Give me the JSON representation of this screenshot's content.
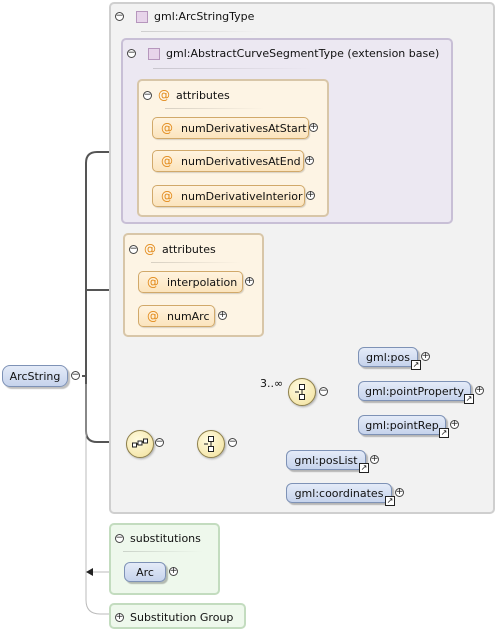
{
  "root": {
    "label": "ArcString"
  },
  "complex_type": {
    "name": "gml:ArcStringType"
  },
  "base_type": {
    "name": "gml:AbstractCurveSegmentType (extension base)"
  },
  "base_attributes": {
    "title": "attributes",
    "items": [
      "numDerivativesAtStart",
      "numDerivativesAtEnd",
      "numDerivativeInterior"
    ]
  },
  "own_attributes": {
    "title": "attributes",
    "items": [
      "interpolation",
      "numArc"
    ]
  },
  "choice": {
    "cardinality": "3..∞",
    "items": [
      "gml:pos",
      "gml:pointProperty",
      "gml:pointRep"
    ]
  },
  "alternatives": [
    "gml:posList",
    "gml:coordinates"
  ],
  "substitutions": {
    "title": "substitutions",
    "items": [
      "Arc"
    ]
  },
  "substitution_group": {
    "label": "Substitution Group"
  },
  "symbols": {
    "collapse": "−",
    "expand": "+",
    "at": "@",
    "link": "↗"
  },
  "colors": {
    "attribute_panel": "#fdf4e4",
    "element_pill": "#c6d3ec",
    "base_panel": "#ece8f2",
    "substitution_panel": "#eef8ec"
  }
}
